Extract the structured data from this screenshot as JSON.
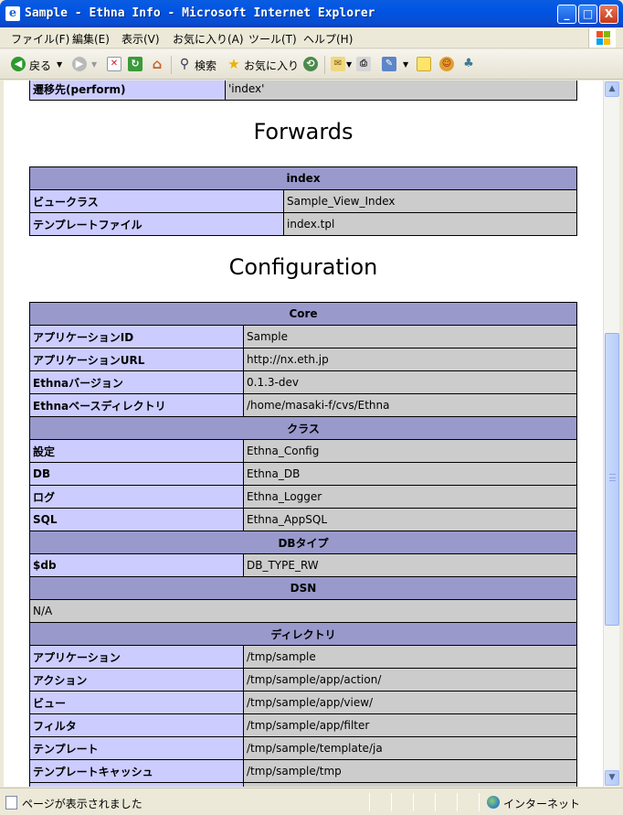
{
  "window": {
    "title": "Sample - Ethna Info - Microsoft Internet Explorer",
    "icon": "ie-icon",
    "buttons": {
      "minimize": "_",
      "maximize": "□",
      "close": "X"
    }
  },
  "menu": {
    "items": [
      "ファイル(F)",
      "編集(E)",
      "表示(V)",
      "お気に入り(A)",
      "ツール(T)",
      "ヘルプ(H)"
    ]
  },
  "toolbar": {
    "back_label": "戻る",
    "search_label": "検索",
    "favorites_label": "お気に入り"
  },
  "content": {
    "top_row": {
      "key": "遷移先(perform)",
      "value": "'index'"
    },
    "forwards": {
      "heading": "Forwards",
      "table_header": "index",
      "rows": [
        {
          "key": "ビュークラス",
          "value": "Sample_View_Index"
        },
        {
          "key": "テンプレートファイル",
          "value": "index.tpl"
        }
      ]
    },
    "configuration": {
      "heading": "Configuration",
      "sections": {
        "core": {
          "header": "Core",
          "rows": [
            {
              "key": "アプリケーションID",
              "value": "Sample"
            },
            {
              "key": "アプリケーションURL",
              "value": "http://nx.eth.jp"
            },
            {
              "key": "Ethnaバージョン",
              "value": "0.1.3-dev"
            },
            {
              "key": "Ethnaベースディレクトリ",
              "value": "/home/masaki-f/cvs/Ethna"
            }
          ]
        },
        "classes": {
          "header": "クラス",
          "rows": [
            {
              "key": "設定",
              "value": "Ethna_Config"
            },
            {
              "key": "DB",
              "value": "Ethna_DB"
            },
            {
              "key": "ログ",
              "value": "Ethna_Logger"
            },
            {
              "key": "SQL",
              "value": "Ethna_AppSQL"
            }
          ]
        },
        "dbtype": {
          "header": "DBタイプ",
          "rows": [
            {
              "key": "$db",
              "value": "DB_TYPE_RW"
            }
          ]
        },
        "dsn": {
          "header": "DSN",
          "value": "N/A"
        },
        "directories": {
          "header": "ディレクトリ",
          "rows": [
            {
              "key": "アプリケーション",
              "value": "/tmp/sample"
            },
            {
              "key": "アクション",
              "value": "/tmp/sample/app/action/"
            },
            {
              "key": "ビュー",
              "value": "/tmp/sample/app/view/"
            },
            {
              "key": "フィルタ",
              "value": "/tmp/sample/app/filter"
            },
            {
              "key": "テンプレート",
              "value": "/tmp/sample/template/ja"
            },
            {
              "key": "テンプレートキャッシュ",
              "value": "/tmp/sample/tmp"
            }
          ]
        }
      }
    }
  },
  "status": {
    "text": "ページが表示されました",
    "zone": "インターネット"
  },
  "colors": {
    "table_header": "#9999cc",
    "key_cell": "#ccccff",
    "value_cell": "#cccccc",
    "titlebar": "#0054e3"
  }
}
